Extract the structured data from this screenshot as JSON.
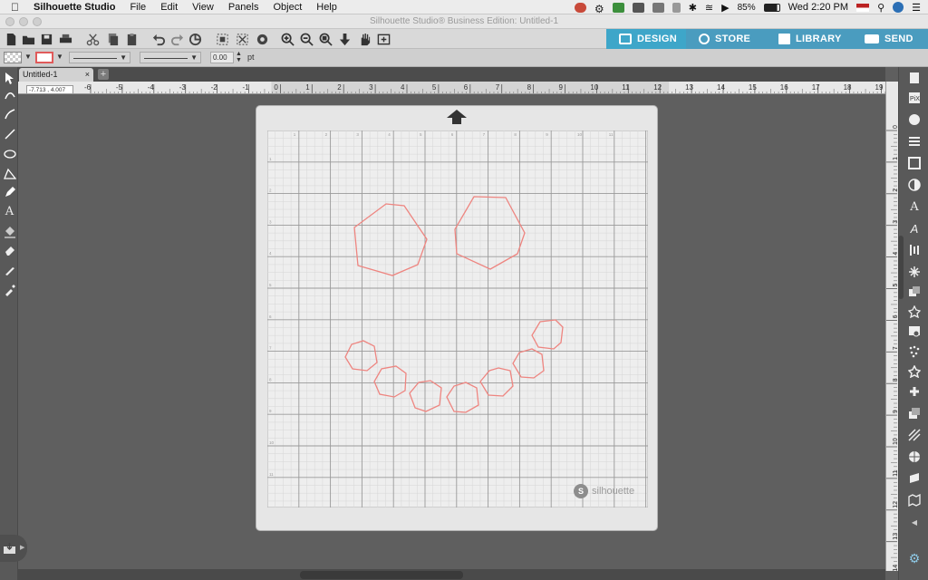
{
  "menubar": {
    "apple": "",
    "app": "Silhouette Studio",
    "items": [
      "File",
      "Edit",
      "View",
      "Panels",
      "Object",
      "Help"
    ],
    "battery": "85%",
    "clock": "Wed 2:20 PM"
  },
  "window": {
    "title": "Silhouette Studio® Business Edition: Untitled-1"
  },
  "nav": {
    "design": "DESIGN",
    "store": "STORE",
    "library": "LIBRARY",
    "send": "SEND",
    "design_color": "#3ea6c9",
    "tab_color": "#4a9cbf"
  },
  "line_settings": {
    "width_value": "0.00",
    "unit": "pt"
  },
  "doc_tab": {
    "name": "Untitled-1",
    "close": "×",
    "add": "+"
  },
  "coords": {
    "readout": "-7.713 , 4.007"
  },
  "ruler": {
    "h_labels": [
      "-6",
      "-5",
      "-4",
      "-3",
      "-2",
      "-1",
      "0",
      "1",
      "2",
      "3",
      "4",
      "5",
      "6",
      "7",
      "8",
      "9",
      "10",
      "11",
      "12",
      "13",
      "14",
      "15",
      "16",
      "17",
      "18",
      "19"
    ],
    "v_labels": [
      "0",
      "1",
      "2",
      "3",
      "4",
      "5",
      "6",
      "7",
      "8",
      "9",
      "10",
      "11",
      "12",
      "13",
      "14",
      "15"
    ]
  },
  "mat": {
    "brand": "silhouette",
    "badge": "S",
    "cols_labels": [
      "1",
      "2",
      "3",
      "4",
      "5",
      "6",
      "7",
      "8",
      "9",
      "10",
      "11"
    ],
    "rows_labels": [
      "1",
      "2",
      "3",
      "4",
      "5",
      "6",
      "7",
      "8",
      "9",
      "10",
      "11",
      "12"
    ]
  },
  "colors": {
    "shape_stroke": "#ee8580",
    "accent": "#3ea6c9"
  }
}
